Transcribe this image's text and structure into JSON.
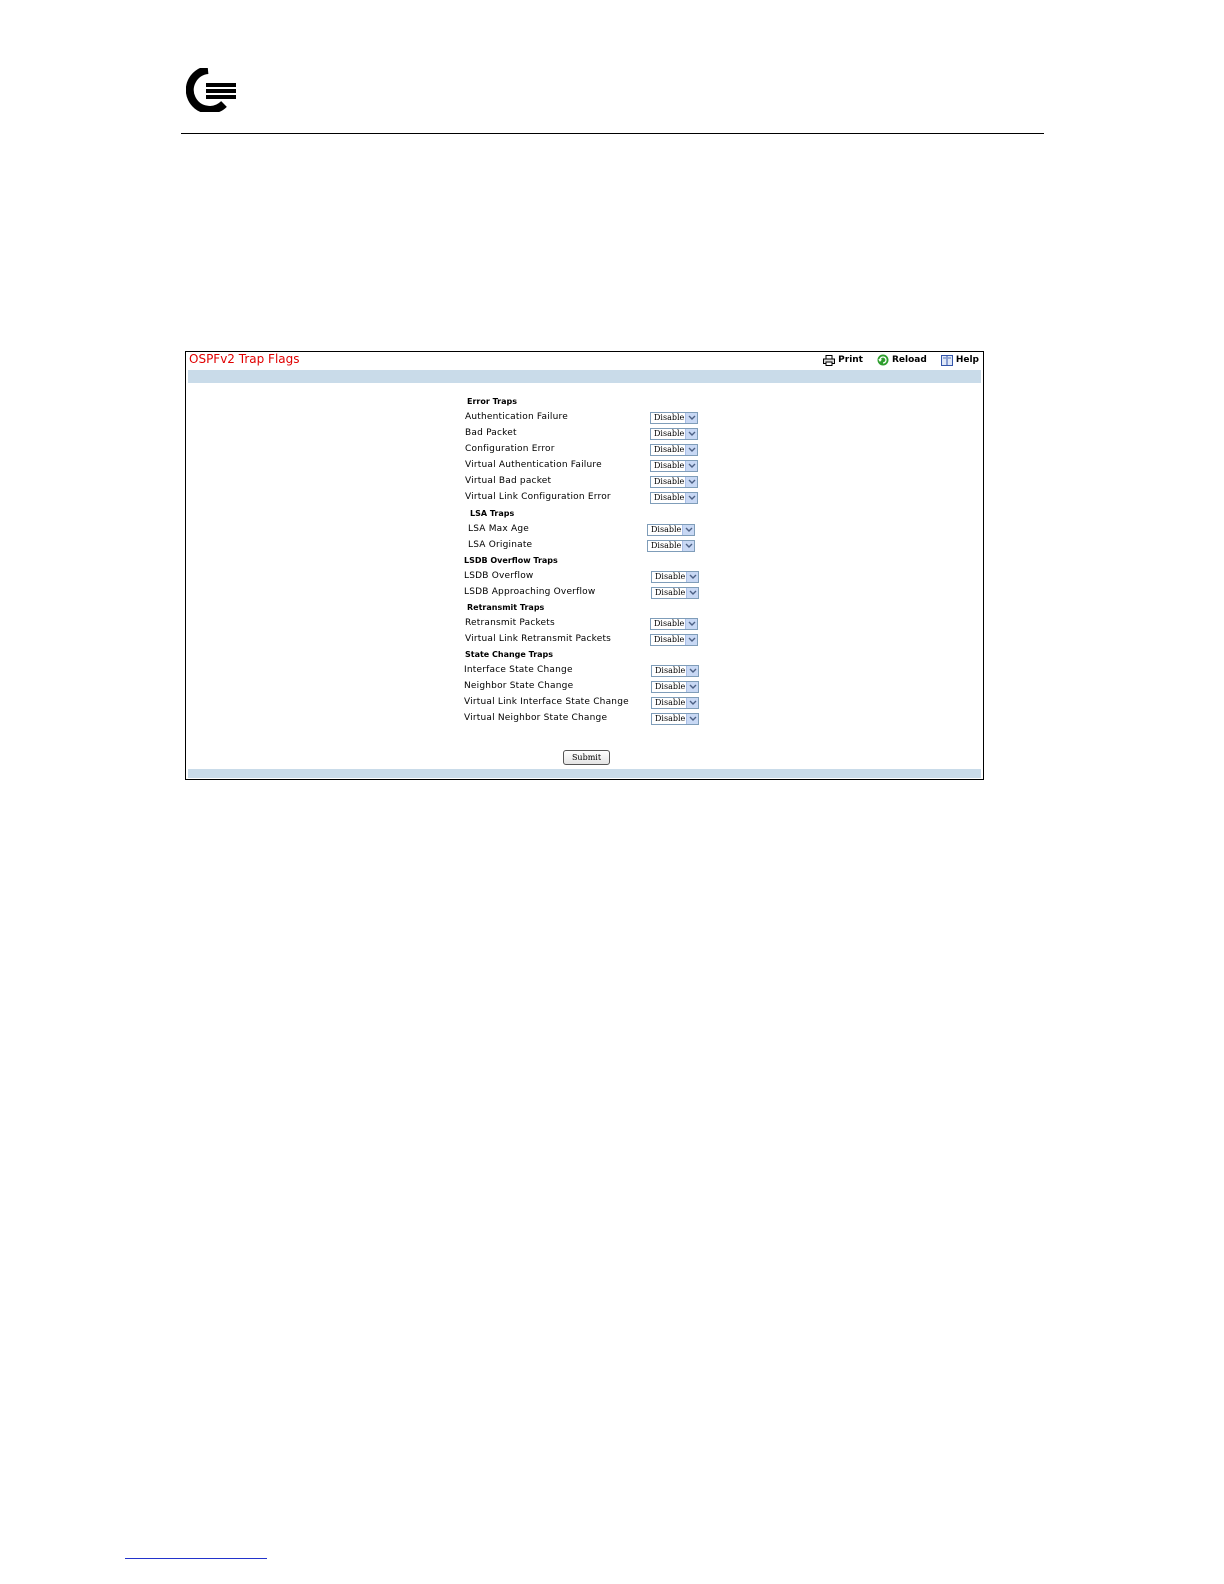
{
  "panel": {
    "title": "OSPFv2 Trap Flags",
    "toolbar": {
      "print": "Print",
      "reload": "Reload",
      "help": "Help"
    }
  },
  "sections": {
    "error": "Error Traps",
    "lsa": "LSA Traps",
    "lsdb": "LSDB Overflow Traps",
    "retransmit": "Retransmit Traps",
    "state": "State Change Traps"
  },
  "fields": {
    "auth_failure": {
      "label": "Authentication Failure",
      "value": "Disable"
    },
    "bad_packet": {
      "label": "Bad Packet",
      "value": "Disable"
    },
    "config_error": {
      "label": "Configuration Error",
      "value": "Disable"
    },
    "virt_auth_failure": {
      "label": "Virtual Authentication Failure",
      "value": "Disable"
    },
    "virt_bad_packet": {
      "label": "Virtual Bad packet",
      "value": "Disable"
    },
    "virt_link_config_error": {
      "label": "Virtual Link Configuration Error",
      "value": "Disable"
    },
    "lsa_max_age": {
      "label": "LSA Max Age",
      "value": "Disable"
    },
    "lsa_originate": {
      "label": "LSA Originate",
      "value": "Disable"
    },
    "lsdb_overflow": {
      "label": "LSDB Overflow",
      "value": "Disable"
    },
    "lsdb_approaching": {
      "label": "LSDB Approaching Overflow",
      "value": "Disable"
    },
    "retransmit_packets": {
      "label": "Retransmit Packets",
      "value": "Disable"
    },
    "virt_link_retransmit": {
      "label": "Virtual Link Retransmit Packets",
      "value": "Disable"
    },
    "if_state_change": {
      "label": "Interface State Change",
      "value": "Disable"
    },
    "nbr_state_change": {
      "label": "Neighbor State Change",
      "value": "Disable"
    },
    "virt_link_if_state": {
      "label": "Virtual Link Interface State Change",
      "value": "Disable"
    },
    "virt_nbr_state": {
      "label": "Virtual Neighbor State Change",
      "value": "Disable"
    }
  },
  "submit_label": "Submit"
}
